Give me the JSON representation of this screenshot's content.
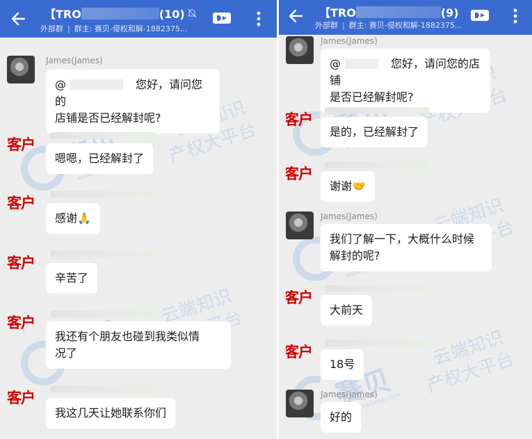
{
  "colors": {
    "header_bg": "#3a6bd1",
    "chat_bg": "#ededed",
    "kehu_red": "#d40000",
    "watermark_blue": "#4087dc"
  },
  "watermark": {
    "brand": "赛贝",
    "tagline_1": "云端知识",
    "tagline_2": "产权大平台",
    "url": "www.saibeiip.com"
  },
  "left": {
    "header": {
      "title_prefix": "【TRO",
      "title_count": "(10)",
      "tag": "外部群",
      "owner": "群主: 赛贝-侵权和解-1882375..."
    },
    "messages": [
      {
        "avatar": "photo",
        "sender": "James(James)",
        "mention": "@",
        "text": "您好，请问您的",
        "text2": "店铺是否已经解封呢?"
      },
      {
        "avatar": "kehu",
        "kehu": "客户",
        "text": "嗯嗯，已经解封了"
      },
      {
        "avatar": "kehu",
        "kehu": "客户",
        "text": "感谢🙏"
      },
      {
        "avatar": "kehu",
        "kehu": "客户",
        "text": "辛苦了"
      },
      {
        "avatar": "kehu",
        "kehu": "客户",
        "text": "我还有个朋友也碰到我类似情",
        "text2": "况了"
      },
      {
        "avatar": "kehu",
        "kehu": "客户",
        "text": "我这几天让她联系你们"
      }
    ]
  },
  "right": {
    "header": {
      "title_prefix": "【TRO",
      "title_count": "(9)",
      "tag": "外部群",
      "owner": "群主: 赛贝-侵权和解-1882375..."
    },
    "messages": [
      {
        "avatar": "photo",
        "sender": "James(James)",
        "mention": "@",
        "text": "您好，请问您的店铺",
        "text2": "是否已经解封呢?"
      },
      {
        "avatar": "kehu",
        "kehu": "客户",
        "text": "是的，已经解封了"
      },
      {
        "avatar": "kehu",
        "kehu": "客户",
        "text": "谢谢🤝"
      },
      {
        "avatar": "photo",
        "sender": "James(James)",
        "text": "我们了解一下，大概什么时候",
        "text2": "解封的呢?"
      },
      {
        "avatar": "kehu",
        "kehu": "客户",
        "text": "大前天"
      },
      {
        "avatar": "kehu",
        "kehu": "客户",
        "text": "18号"
      },
      {
        "avatar": "photo",
        "sender": "James(James)",
        "text": "好的"
      }
    ]
  }
}
